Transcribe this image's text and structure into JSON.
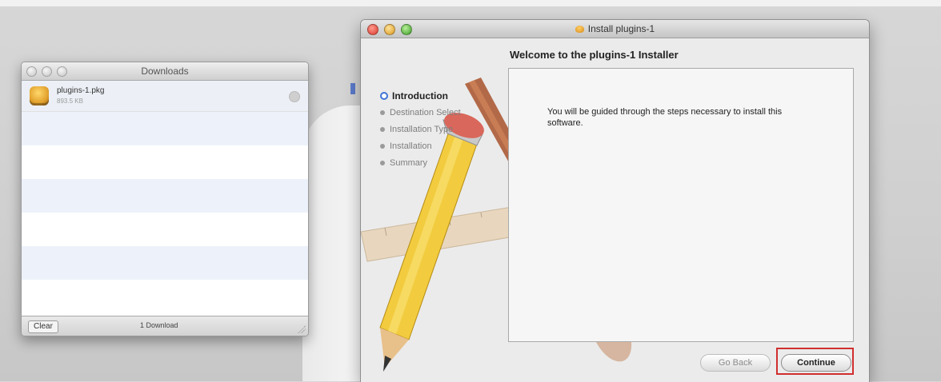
{
  "downloads_window": {
    "title": "Downloads",
    "item": {
      "name": "plugins-1.pkg",
      "size": "893.5 KB"
    },
    "clear_label": "Clear",
    "count_label": "1 Download"
  },
  "installer_window": {
    "title": "Install plugins-1",
    "heading": "Welcome to the plugins-1 Installer",
    "steps": [
      {
        "label": "Introduction"
      },
      {
        "label": "Destination Select"
      },
      {
        "label": "Installation Type"
      },
      {
        "label": "Installation"
      },
      {
        "label": "Summary"
      }
    ],
    "active_step": "Introduction",
    "body_text": "You will be guided through the steps necessary to install this software.",
    "go_back_label": "Go Back",
    "continue_label": "Continue"
  },
  "colors": {
    "highlight": "#d12f2f",
    "active_step_ring": "#4274d6"
  }
}
